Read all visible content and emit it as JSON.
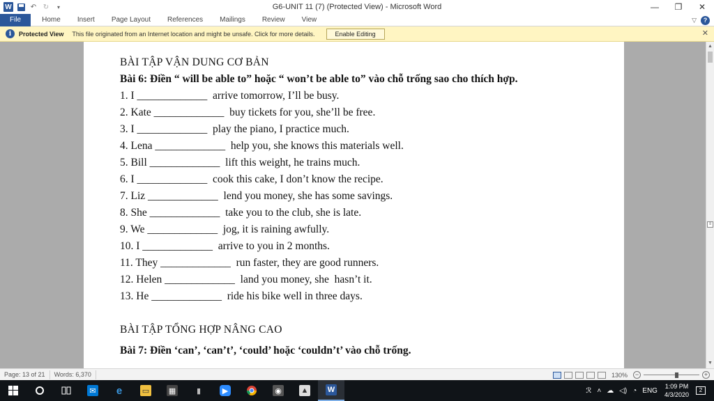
{
  "window": {
    "title": "G6-UNIT 11 (7) (Protected View)  -  Microsoft Word",
    "app_logo": "W",
    "minimize": "—",
    "restore": "❐",
    "close": "✕"
  },
  "ribbon": {
    "tabs": [
      "File",
      "Home",
      "Insert",
      "Page Layout",
      "References",
      "Mailings",
      "Review",
      "View"
    ],
    "help": "?"
  },
  "protected_view": {
    "title": "Protected View",
    "message": "This file originated from an Internet location and might be unsafe. Click for more details.",
    "button": "Enable Editing",
    "info_glyph": "i",
    "close": "✕"
  },
  "document": {
    "heading1": "BÀI TẬP VẬN DUNG CƠ BẢN",
    "instruction": "Bài 6: Điền “ will be able to” hoặc “ won’t be able to” vào chỗ trống sao cho thích hợp.",
    "exercises": [
      "1. I _____________  arrive tomorrow, I’ll be busy.",
      "2. Kate _____________  buy tickets for you, she’ll be free.",
      "3. I _____________  play the piano, I practice much.",
      "4. Lena _____________  help you, she knows this materials well.",
      "5. Bill _____________  lift this weight, he trains much.",
      "6. I _____________  cook this cake, I don’t know the recipe.",
      "7. Liz _____________  lend you money, she has some savings.",
      "8. She _____________  take you to the club, she is late.",
      "9. We _____________  jog, it is raining awfully.",
      "10. I _____________  arrive to you in 2 months.",
      "11. They _____________  run faster, they are good runners.",
      "12. Helen _____________  land you money, she  hasn’t it.",
      "13. He _____________  ride his bike well in three days."
    ],
    "heading2": "BÀI TẬP TỔNG HỢP NÂNG CAO",
    "next_instruction": "Bài 7: Điền ‘can’, ‘can’t’, ‘could’ hoặc ‘couldn’t’ vào chỗ trống."
  },
  "statusbar": {
    "page": "Page: 13 of 21",
    "words": "Words: 6,370",
    "zoom": "130%",
    "zoom_fraction": 0.6
  },
  "taskbar": {
    "lang": "ENG",
    "time": "1:09 PM",
    "date": "4/3/2020",
    "notifications": "2"
  },
  "colors": {
    "word_blue": "#2b579a",
    "protected_bg": "#fff5c2",
    "taskbar_bg": "#101418"
  }
}
